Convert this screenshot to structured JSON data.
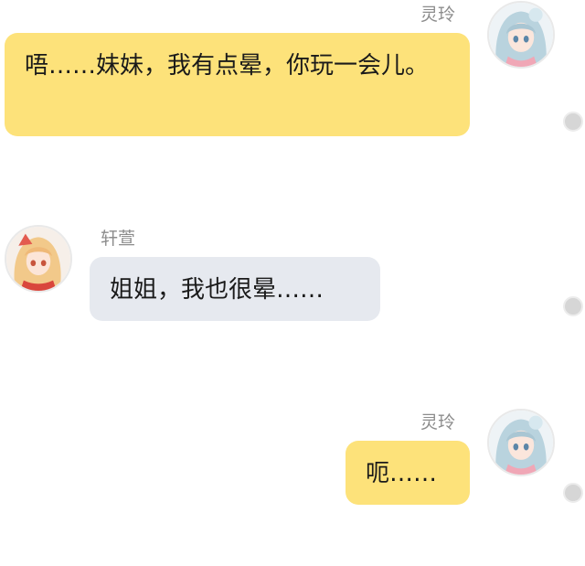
{
  "messages": [
    {
      "sender": "灵玲",
      "text": "唔……妹妹，我有点晕，你玩一会儿。",
      "avatar_icon": "lingling-avatar-icon",
      "side": "right"
    },
    {
      "sender": "轩萱",
      "text": "姐姐，我也很晕……",
      "avatar_icon": "xuanxuan-avatar-icon",
      "side": "left"
    },
    {
      "sender": "灵玲",
      "text": "呃……",
      "avatar_icon": "lingling-avatar-icon",
      "side": "right"
    }
  ],
  "colors": {
    "my_bubble": "#fde27a",
    "other_bubble": "#e6e9ef",
    "name_text": "#8c8c8c",
    "message_text": "#1a1a1a",
    "select_dot": "#d6d6d6"
  }
}
